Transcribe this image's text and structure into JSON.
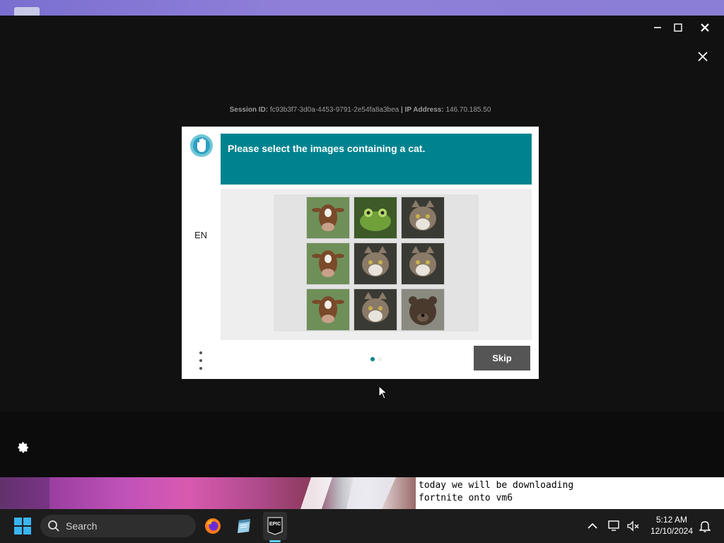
{
  "session": {
    "session_label": "Session ID:",
    "session_id": "fc93b3f7-3d0a-4453-9791-2e54fa8a3bea",
    "separator": "|",
    "ip_label": "IP Address:",
    "ip_address": "146.70.185.50"
  },
  "captcha": {
    "prompt": "Please select the images containing a cat.",
    "language": "EN",
    "skip_label": "Skip",
    "accent_color": "#00838f",
    "page_indicator": {
      "current": 1,
      "total": 2
    },
    "tiles": [
      {
        "subject": "cow"
      },
      {
        "subject": "frog"
      },
      {
        "subject": "cat"
      },
      {
        "subject": "cow"
      },
      {
        "subject": "cat"
      },
      {
        "subject": "cat"
      },
      {
        "subject": "cow"
      },
      {
        "subject": "cat"
      },
      {
        "subject": "bear"
      }
    ]
  },
  "caption": {
    "lines": [
      "today we will be downloading",
      "fortnite onto vm6"
    ]
  },
  "taskbar": {
    "search_label": "Search",
    "epic_icon_text": "EPIC",
    "time": "5:12 AM",
    "date": "12/10/2024"
  }
}
